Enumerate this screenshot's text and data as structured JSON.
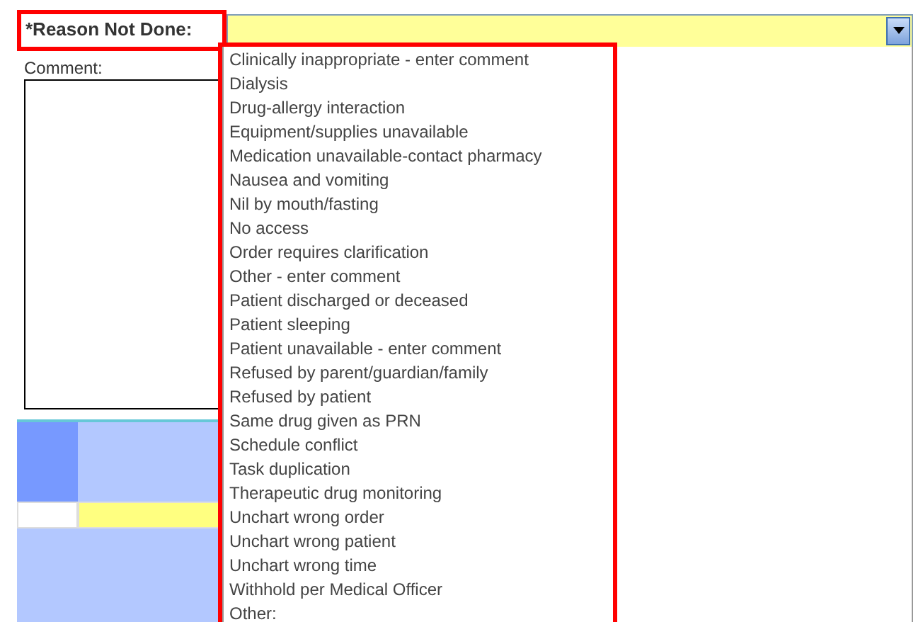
{
  "reason_field": {
    "label": "*Reason Not Done:",
    "dropdown_open": true
  },
  "comment": {
    "label": "Comment:"
  },
  "dropdown": {
    "options": [
      "Clinically inappropriate - enter comment",
      "Dialysis",
      "Drug-allergy interaction",
      "Equipment/supplies unavailable",
      "Medication unavailable-contact pharmacy",
      "Nausea and vomiting",
      "Nil by mouth/fasting",
      "No access",
      "Order requires clarification",
      "Other - enter comment",
      "Patient discharged or deceased",
      "Patient sleeping",
      "Patient unavailable - enter comment",
      "Refused by parent/guardian/family",
      "Refused by patient",
      "Same drug given as PRN",
      "Schedule conflict",
      "Task duplication",
      "Therapeutic drug monitoring",
      "Unchart wrong order",
      "Unchart wrong patient",
      "Unchart wrong time",
      "Withhold per Medical Officer",
      "Other:"
    ]
  }
}
